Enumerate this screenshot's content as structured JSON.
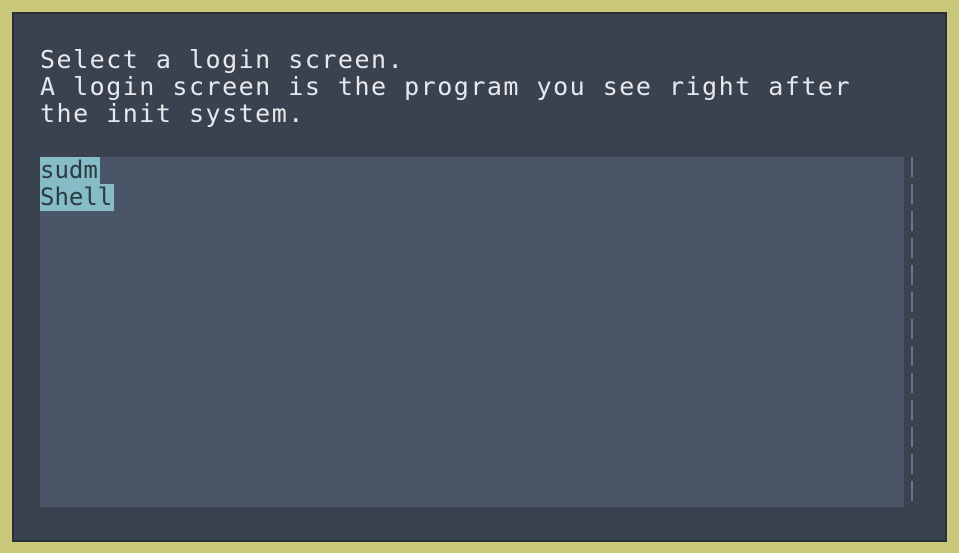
{
  "prompt": {
    "line1": "Select a login screen.",
    "line2": "A login screen is the program you see right after",
    "line3": "the init system."
  },
  "login_screens": {
    "items": [
      {
        "label": "sudm"
      },
      {
        "label": "Shell"
      }
    ],
    "highlight_color": "#86bcc5",
    "list_bg": "#4a5568"
  },
  "colors": {
    "frame": "#c9c77a",
    "window_bg": "#3a414f",
    "text": "#e6e8ec"
  }
}
